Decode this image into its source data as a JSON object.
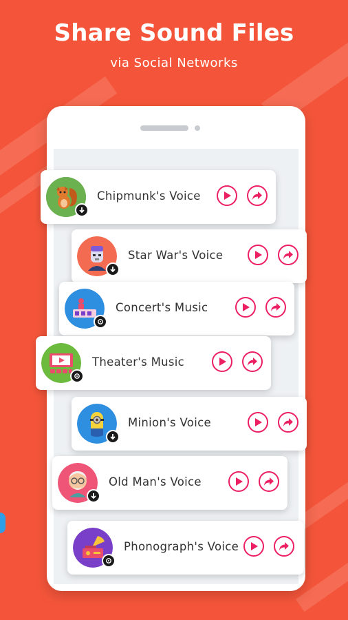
{
  "header": {
    "title": "Share Sound Files",
    "subtitle": "via Social Networks"
  },
  "colors": {
    "background": "#f4553a",
    "accent": "#ec1f63"
  },
  "voices": [
    {
      "label": "Chipmunk's Voice",
      "icon": "squirrel-icon",
      "badge": "download-icon",
      "color": "#5dab4f"
    },
    {
      "label": "Star War's Voice",
      "icon": "stormtrooper-icon",
      "badge": "download-icon",
      "color": "#f36c51"
    },
    {
      "label": "Concert's Music",
      "icon": "concert-icon",
      "badge": "share-badge-icon",
      "color": "#2e8ee0"
    },
    {
      "label": "Theater's Music",
      "icon": "theater-icon",
      "badge": "share-badge-icon",
      "color": "#6cbb3f"
    },
    {
      "label": "Minion's Voice",
      "icon": "minion-icon",
      "badge": "download-icon",
      "color": "#2e8ee0"
    },
    {
      "label": "Old Man's Voice",
      "icon": "old-man-icon",
      "badge": "download-icon",
      "color": "#ee5577"
    },
    {
      "label": "Phonograph's Voice",
      "icon": "phonograph-icon",
      "badge": "share-badge-icon",
      "color": "#7a3fc9"
    }
  ]
}
